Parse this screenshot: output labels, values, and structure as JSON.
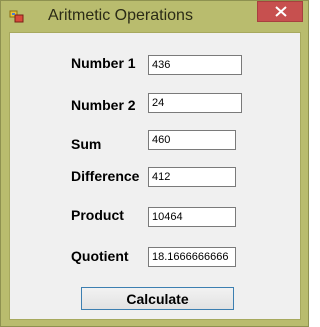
{
  "window": {
    "title": "Aritmetic Operations"
  },
  "form": {
    "number1_label": "Number 1",
    "number1_value": "436",
    "number2_label": "Number 2",
    "number2_value": "24",
    "sum_label": "Sum",
    "sum_value": "460",
    "difference_label": "Difference",
    "difference_value": "412",
    "product_label": "Product",
    "product_value": "10464",
    "quotient_label": "Quotient",
    "quotient_value": "18.1666666666",
    "calculate_label": "Calculate"
  },
  "icons": {
    "app": "app-icon",
    "close": "close-icon"
  },
  "colors": {
    "frame": "#b9bc6e",
    "close_button": "#c7504f",
    "client": "#f0f0f0",
    "button_border": "#3c7fb1"
  }
}
